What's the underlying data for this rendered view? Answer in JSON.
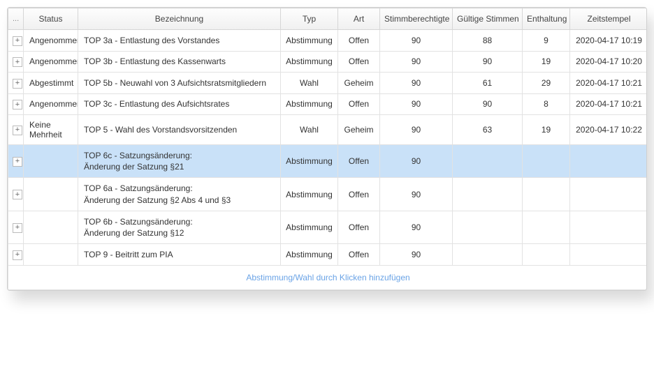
{
  "columns": {
    "expander": "...",
    "status": "Status",
    "bezeichnung": "Bezeichnung",
    "typ": "Typ",
    "art": "Art",
    "stimmberechtigte": "Stimmberechtigte",
    "gueltige": "Gültige Stimmen",
    "enthaltung": "Enthaltung",
    "zeitstempel": "Zeitstempel"
  },
  "rows": [
    {
      "status": "Angenommen",
      "bezeichnung": "TOP 3a - Entlastung des Vorstandes",
      "typ": "Abstimmung",
      "art": "Offen",
      "stimm": "90",
      "gueltig": "88",
      "enth": "9",
      "zeit": "2020-04-17 10:19",
      "selected": false
    },
    {
      "status": "Angenommen",
      "bezeichnung": "TOP 3b - Entlastung des Kassenwarts",
      "typ": "Abstimmung",
      "art": "Offen",
      "stimm": "90",
      "gueltig": "90",
      "enth": "19",
      "zeit": "2020-04-17 10:20",
      "selected": false
    },
    {
      "status": "Abgestimmt",
      "bezeichnung": "TOP 5b - Neuwahl von 3 Aufsichtsratsmitgliedern",
      "typ": "Wahl",
      "art": "Geheim",
      "stimm": "90",
      "gueltig": "61",
      "enth": "29",
      "zeit": "2020-04-17 10:21",
      "selected": false
    },
    {
      "status": "Angenommen",
      "bezeichnung": "TOP 3c - Entlastung des Aufsichtsrates",
      "typ": "Abstimmung",
      "art": "Offen",
      "stimm": "90",
      "gueltig": "90",
      "enth": "8",
      "zeit": "2020-04-17 10:21",
      "selected": false
    },
    {
      "status": "Keine Mehrheit",
      "bezeichnung": "TOP 5 - Wahl des Vorstandsvorsitzenden",
      "typ": "Wahl",
      "art": "Geheim",
      "stimm": "90",
      "gueltig": "63",
      "enth": "19",
      "zeit": "2020-04-17 10:22",
      "selected": false
    },
    {
      "status": "",
      "bezeichnung": "TOP 6c - Satzungsänderung:\nÄnderung der Satzung §21",
      "typ": "Abstimmung",
      "art": "Offen",
      "stimm": "90",
      "gueltig": "",
      "enth": "",
      "zeit": "",
      "selected": true
    },
    {
      "status": "",
      "bezeichnung": "TOP 6a - Satzungsänderung:\nÄnderung der Satzung §2 Abs 4 und §3",
      "typ": "Abstimmung",
      "art": "Offen",
      "stimm": "90",
      "gueltig": "",
      "enth": "",
      "zeit": "",
      "selected": false
    },
    {
      "status": "",
      "bezeichnung": "TOP 6b - Satzungsänderung:\nÄnderung der Satzung §12",
      "typ": "Abstimmung",
      "art": "Offen",
      "stimm": "90",
      "gueltig": "",
      "enth": "",
      "zeit": "",
      "selected": false
    },
    {
      "status": "",
      "bezeichnung": "TOP 9 - Beitritt zum PIA",
      "typ": "Abstimmung",
      "art": "Offen",
      "stimm": "90",
      "gueltig": "",
      "enth": "",
      "zeit": "",
      "selected": false
    }
  ],
  "footer": {
    "add_link": "Abstimmung/Wahl durch Klicken hinzufügen"
  },
  "icons": {
    "expand": "+"
  }
}
